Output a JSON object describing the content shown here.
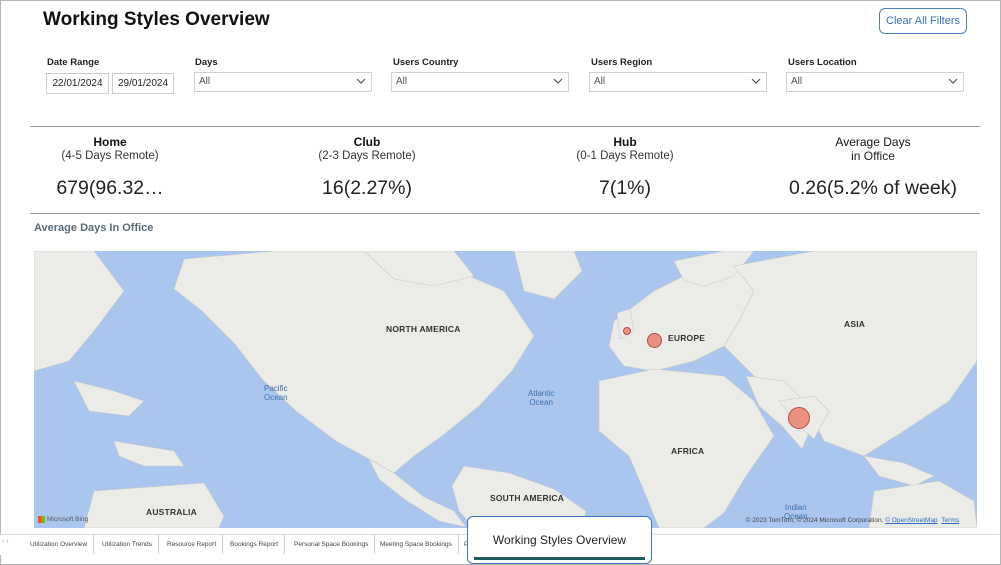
{
  "page": {
    "title": "Working Styles Overview",
    "clear_filters": "Clear All Filters"
  },
  "filters": {
    "date_range": {
      "label": "Date Range",
      "start": "22/01/2024",
      "end": "29/01/2024"
    },
    "days": {
      "label": "Days",
      "value": "All"
    },
    "users_country": {
      "label": "Users Country",
      "value": "All"
    },
    "users_region": {
      "label": "Users Region",
      "value": "All"
    },
    "users_location": {
      "label": "Users Location",
      "value": "All"
    }
  },
  "kpis": [
    {
      "title": "Home",
      "subtitle": "(4-5 Days Remote)",
      "value": "679(96.32…"
    },
    {
      "title": "Club",
      "subtitle": "(2-3 Days Remote)",
      "value": "16(2.27%)"
    },
    {
      "title": "Hub",
      "subtitle": "(0-1 Days Remote)",
      "value": "7(1%)"
    },
    {
      "title": "Average Days",
      "subtitle": "in Office",
      "value": "0.26(5.2% of week)"
    }
  ],
  "map": {
    "title": "Average Days In Office",
    "labels": {
      "north_america": "NORTH AMERICA",
      "europe": "EUROPE",
      "asia": "ASIA",
      "africa": "AFRICA",
      "south_america": "SOUTH AMERICA",
      "australia": "AUSTRALIA"
    },
    "oceans": {
      "pacific_1": "Pacific",
      "pacific_2": "Ocean",
      "atlantic_1": "Atlantic",
      "atlantic_2": "Ocean",
      "indian_1": "Indian",
      "indian_2": "Ocean"
    },
    "provider": "Microsoft Bing",
    "attribution": "© 2023 TomTom, © 2024 Microsoft Corporation,",
    "attribution_link": "© OpenStreetMap",
    "terms": "Terms",
    "colors": {
      "water": "#aac6ef",
      "land": "#e9e9e6",
      "bubble": "#ec8070"
    }
  },
  "tabs": {
    "nav": "‹ ›",
    "items": [
      "Utilization Overview",
      "Utilization Trends",
      "Resource Report",
      "Bookings Report",
      "Personal Space Bookings",
      "Meeting Space Bookings",
      "P"
    ],
    "active": "Working Styles Overview"
  }
}
